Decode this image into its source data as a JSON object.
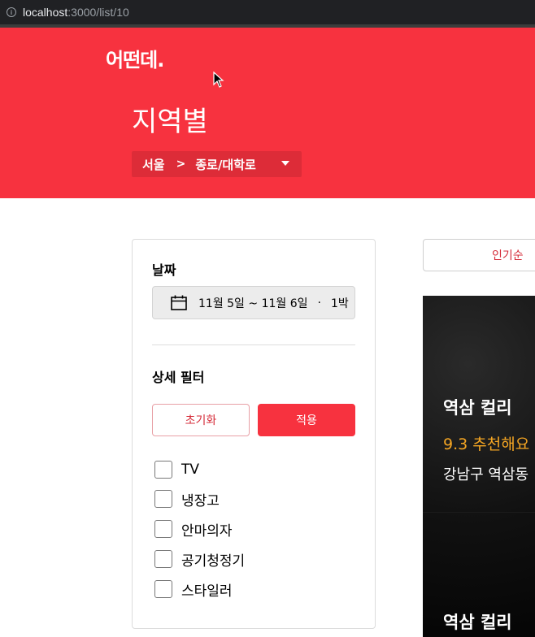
{
  "browser": {
    "url_host": "localhost",
    "url_path": ":3000/list/10"
  },
  "header": {
    "logo": "어떤데.",
    "title": "지역별",
    "breadcrumb": {
      "region": "서울",
      "separator": ">",
      "area": "종로/대학로"
    }
  },
  "filter": {
    "date_title": "날짜",
    "date_range": "11월 5일 ~ 11월 6일",
    "date_dot": "·",
    "nights": "1박",
    "detail_title": "상세 필터",
    "reset_label": "초기화",
    "apply_label": "적용",
    "options": [
      {
        "label": "TV",
        "checked": false
      },
      {
        "label": "냉장고",
        "checked": false
      },
      {
        "label": "안마의자",
        "checked": false
      },
      {
        "label": "공기청정기",
        "checked": false
      },
      {
        "label": "스타일러",
        "checked": false
      }
    ]
  },
  "sort": {
    "selected": "인기순"
  },
  "listings": [
    {
      "name": "역삼 컬리",
      "rating": "9.3 추천해요",
      "address": "강남구 역삼동"
    },
    {
      "name": "역삼 컬리"
    }
  ],
  "colors": {
    "brand": "#f7323f",
    "accent_text": "#d52b38",
    "rating": "#f5a623"
  }
}
